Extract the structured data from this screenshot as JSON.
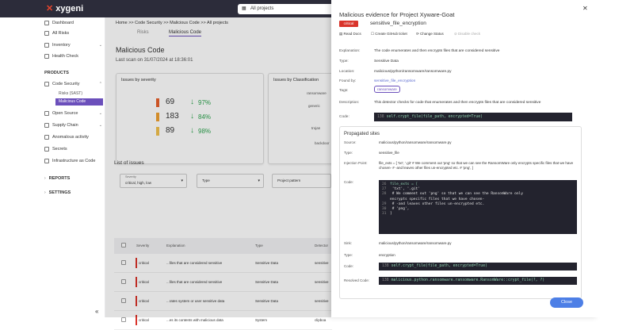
{
  "app": {
    "logo": "xygeni",
    "project_selector": "All projects"
  },
  "sidebar": {
    "items": [
      {
        "label": "Dashboard"
      },
      {
        "label": "All Risks"
      },
      {
        "label": "Inventory"
      },
      {
        "label": "Health Check"
      }
    ],
    "products_header": "PRODUCTS",
    "products": [
      {
        "label": "Code Security"
      },
      {
        "label": "Open Source"
      },
      {
        "label": "Supply Chain"
      },
      {
        "label": "Anomalous activity"
      },
      {
        "label": "Secrets"
      },
      {
        "label": "Infrastructure as Code"
      }
    ],
    "code_security_sub": [
      {
        "label": "Risks (SAST)"
      },
      {
        "label": "Malicious Code"
      }
    ],
    "reports": "REPORTS",
    "settings": "SETTINGS",
    "collapse_glyph": "«"
  },
  "main": {
    "breadcrumb": "Home >> Code Security >> Malicious Code >> All projects",
    "tabs": [
      "Risks",
      "Malicious Code"
    ],
    "title": "Malicious Code",
    "last_scan": "Last scan on 31/07/2024 at 18:36:01",
    "issues_by_severity": {
      "title": "Issues by severity",
      "rows": [
        {
          "count": "69",
          "pct": "97%",
          "color": "#e8602c"
        },
        {
          "count": "183",
          "pct": "84%",
          "color": "#f0a030"
        },
        {
          "count": "89",
          "pct": "98%",
          "color": "#f2c14e"
        }
      ]
    },
    "issues_by_classification": {
      "title": "Issues by Classification",
      "labels": [
        "ransomware",
        "generic",
        "trojan",
        "backdoor"
      ]
    },
    "list": {
      "title": "List of issues",
      "filters": {
        "severity_label": "Severity",
        "severity_value": "critical, high, low",
        "type_placeholder": "Type",
        "project_placeholder": "Project pattern"
      },
      "columns": [
        "Severity",
        "Explanation",
        "Type",
        "Detector"
      ],
      "rows": [
        {
          "severity": "critical",
          "explanation": "...files that are considered sensitive",
          "type": "Sensitive Data",
          "detector": "sensitive"
        },
        {
          "severity": "critical",
          "explanation": "...files that are considered sensitive",
          "type": "Sensitive Data",
          "detector": "sensitive"
        },
        {
          "severity": "critical",
          "explanation": "...rates system or user sensitive data",
          "type": "Sensitive Data",
          "detector": "sensitive"
        },
        {
          "severity": "critical",
          "explanation": "...es its contents with malicious data",
          "type": "System",
          "detector": "clipboa"
        }
      ]
    }
  },
  "panel": {
    "title": "Malicious evidence for Project Xyware-Goat",
    "severity_badge": "critical",
    "detector": "sensitive_file_encryption",
    "actions": [
      "Read Docs",
      "Create GitHub ticket",
      "Change Status",
      "Disable check"
    ],
    "fields": {
      "explanation_label": "Explanation:",
      "explanation": "The code enumerates and then encrypts files that are considered sensitive",
      "type_label": "Type:",
      "type": "Sensitive Data",
      "location_label": "Location:",
      "location": "malicious/python/ransomware/ransomware.py",
      "found_by_label": "Found by:",
      "found_by": "sensitive_file_encryption",
      "tags_label": "Tags:",
      "tag": "ransomware",
      "description_label": "Description:",
      "description": "This detector checks for code that enumerates and then encrypts files that are considered sensitive",
      "code_label": "Code:",
      "code_line_no": "138",
      "code": "self.crypt_file(file_path, encrypted=True)"
    },
    "propagated": {
      "title": "Propagated sites",
      "source_label": "Source:",
      "source": "malicious/python/ransomware/ransomware.py",
      "type_label": "Type:",
      "type": "sensitive_file",
      "injection_label": "Injection Point:",
      "injection": "file_exts = [ 'txt', '.git' # We comment out 'png' so that we can see the RansomWare only encrypts specific files that we have chosen- # -and leaves other files un-encrypted etc. # 'png', ]",
      "code_label": "Code:",
      "code_lines": [
        {
          "n": "26",
          "t": "file_exts = ["
        },
        {
          "n": "27",
          "t": "    'txt', '.git'"
        },
        {
          "n": "28",
          "t": "    # We comment out 'png' so that we can see the RansomWare only"
        },
        {
          "n": "",
          "t": "encrypts specific files that we have chosen-"
        },
        {
          "n": "29",
          "t": "    # -and leaves other files un-encrypted etc."
        },
        {
          "n": "30",
          "t": "    # 'png',"
        },
        {
          "n": "31",
          "t": "]"
        }
      ],
      "sink_label": "Sink:",
      "sink": "malicious/python/ransomware/ransomware.py",
      "sink_type_label": "Type:",
      "sink_type": "encryption",
      "sink_code_label": "Code:",
      "sink_code_line_no": "138",
      "sink_code": "self.crypt_file(file_path, encrypted=True)",
      "resolved_label": "Resolved Code:",
      "resolved_line_no": "138",
      "resolved_code": "malicious.python.ransomware.ransomware.RansomWare::crypt_file(?, ?)"
    },
    "close_label": "Close"
  }
}
